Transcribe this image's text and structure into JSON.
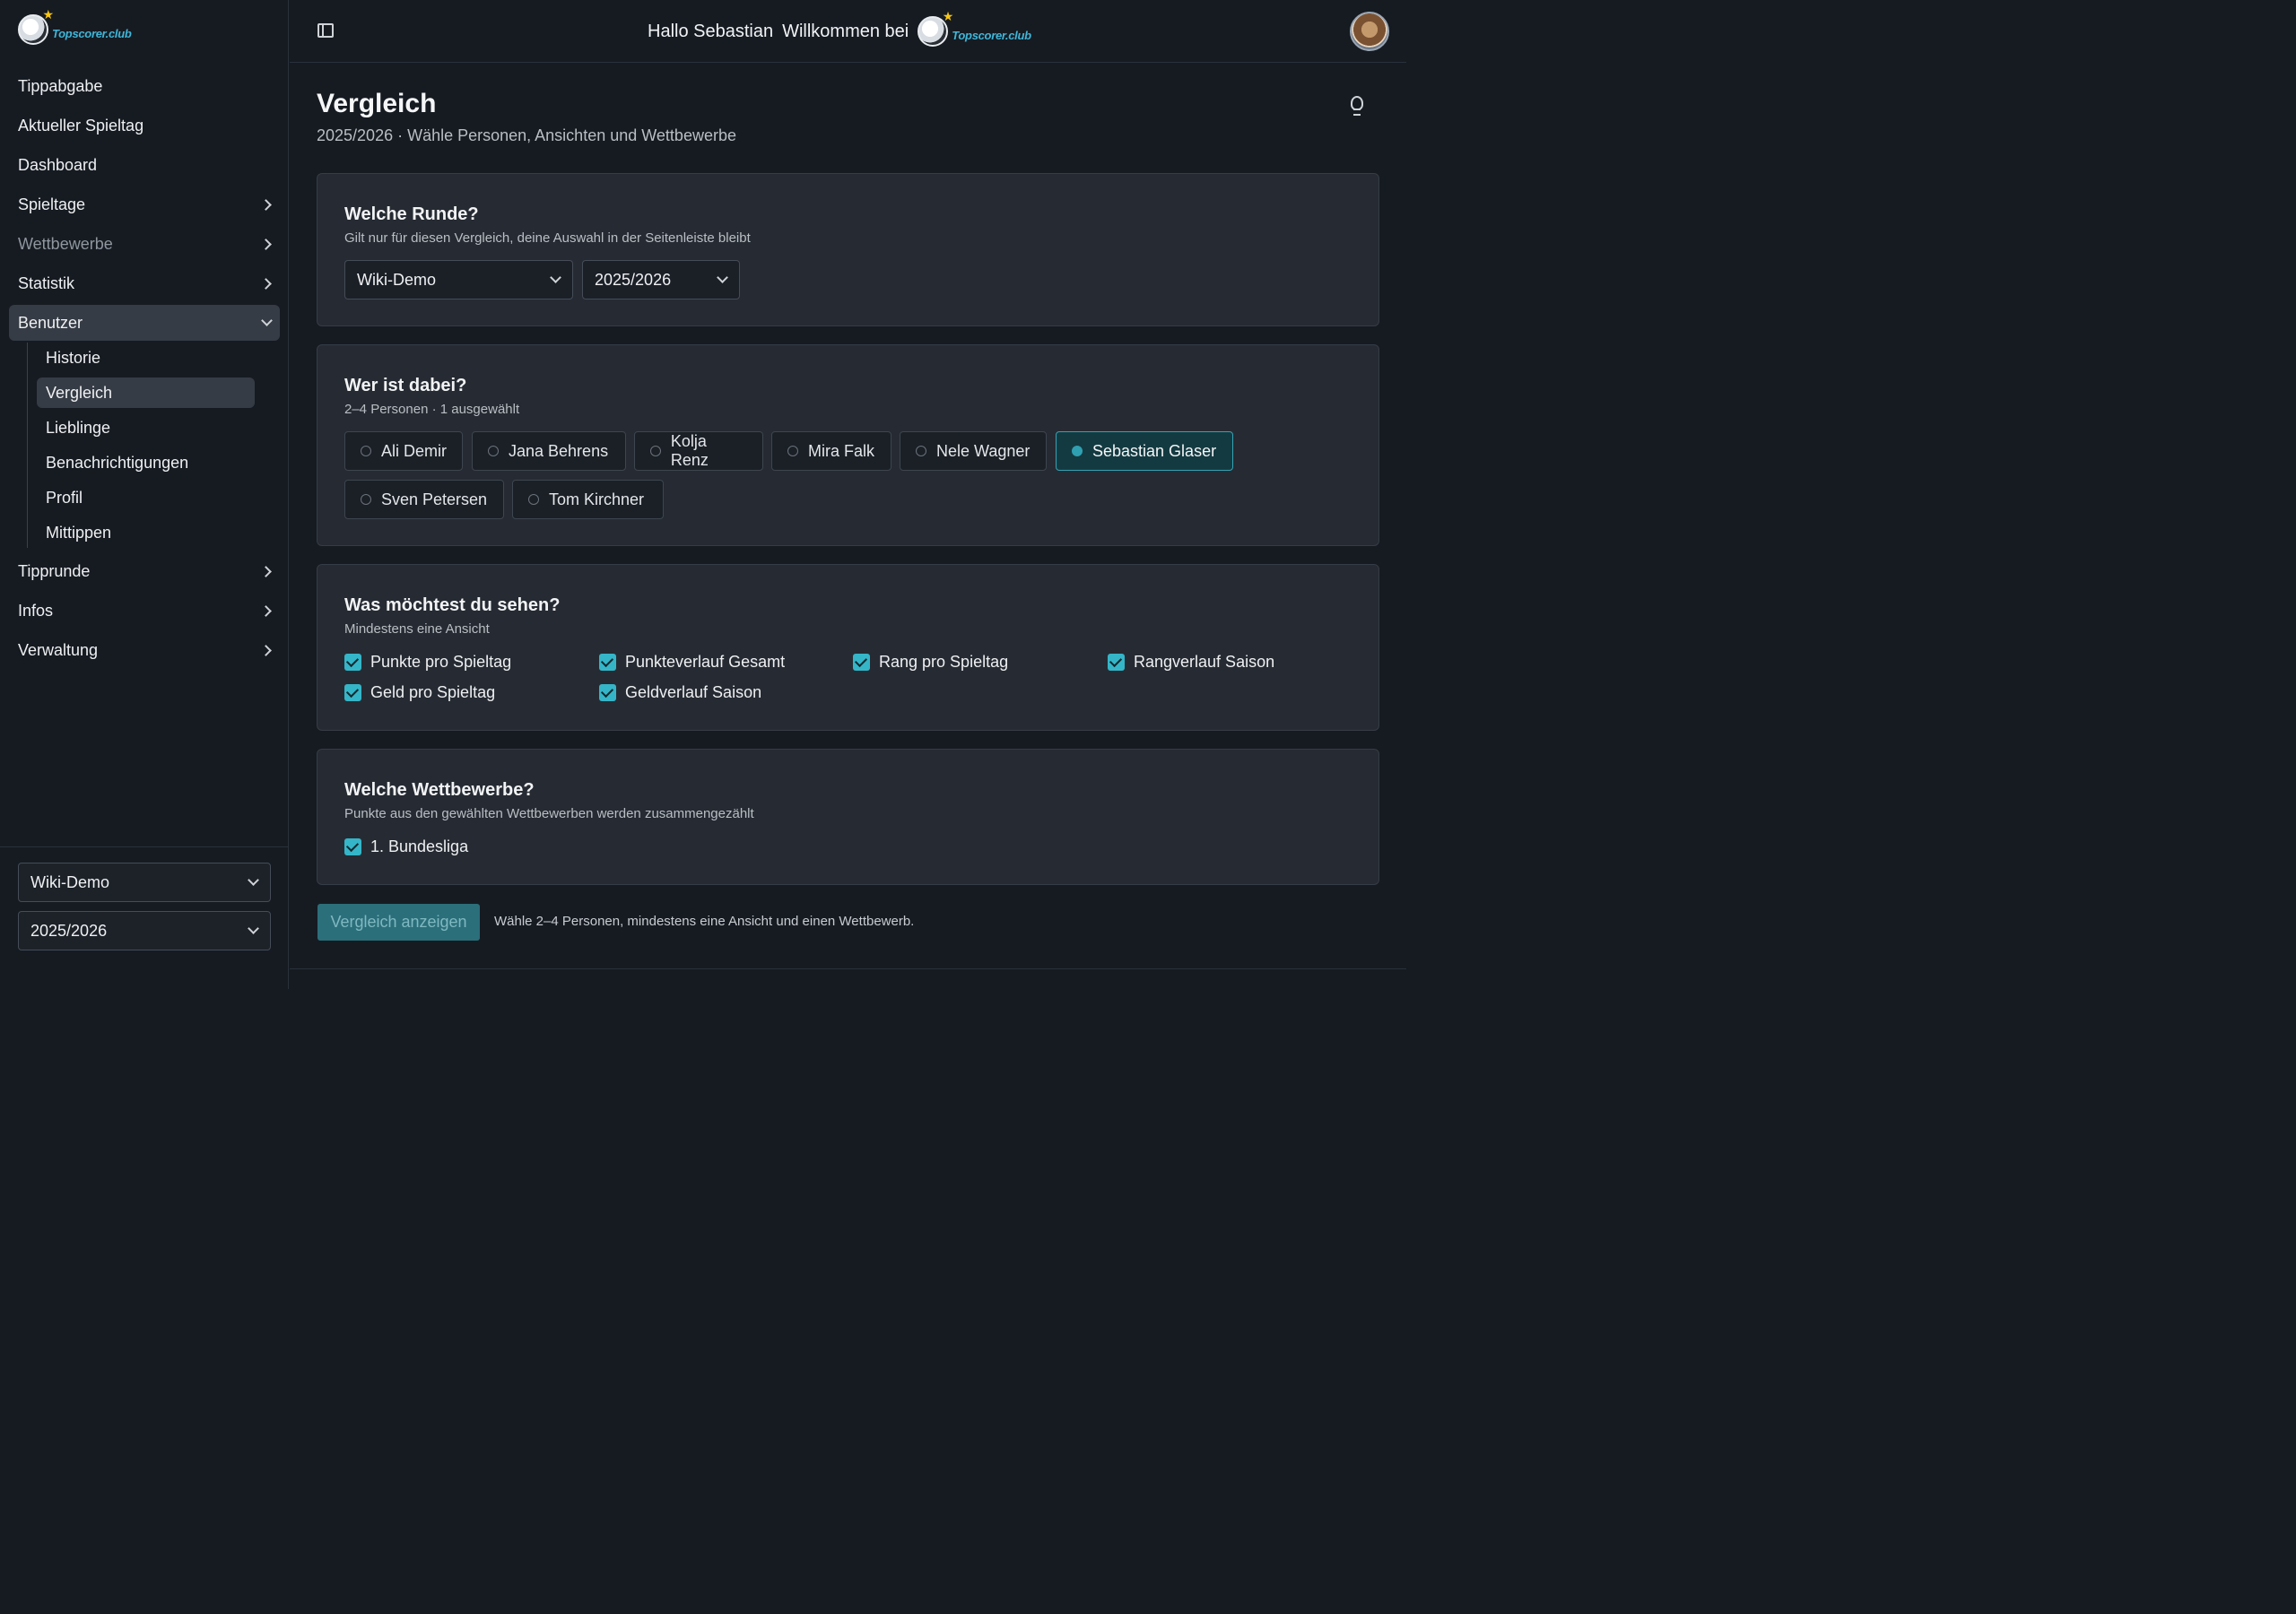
{
  "brand": {
    "logo_text": "Topscorer.club",
    "accent": "#35b5c8"
  },
  "header": {
    "greeting_hello": "Hallo Sebastian",
    "greeting_welcome": "Willkommen bei",
    "logo_text": "Topscorer.club"
  },
  "sidebar": {
    "items": [
      {
        "label": "Tippabgabe"
      },
      {
        "label": "Aktueller Spieltag"
      },
      {
        "label": "Dashboard"
      },
      {
        "label": "Spieltage"
      },
      {
        "label": "Wettbewerbe"
      },
      {
        "label": "Statistik"
      },
      {
        "label": "Benutzer"
      },
      {
        "label": "Tipprunde"
      },
      {
        "label": "Infos"
      },
      {
        "label": "Verwaltung"
      }
    ],
    "benutzer_sub": [
      {
        "label": "Historie"
      },
      {
        "label": "Vergleich"
      },
      {
        "label": "Lieblinge"
      },
      {
        "label": "Benachrichtigungen"
      },
      {
        "label": "Profil"
      },
      {
        "label": "Mittippen"
      }
    ],
    "round_select": "Wiki-Demo",
    "season_select": "2025/2026"
  },
  "page": {
    "title": "Vergleich",
    "subtitle": "2025/2026 · Wähle Personen, Ansichten und Wettbewerbe"
  },
  "round_card": {
    "title": "Welche Runde?",
    "desc": "Gilt nur für diesen Vergleich, deine Auswahl in der Seitenleiste bleibt",
    "round_value": "Wiki-Demo",
    "season_value": "2025/2026"
  },
  "people_card": {
    "title": "Wer ist dabei?",
    "desc": "2–4 Personen · 1 ausgewählt",
    "people": [
      {
        "name": "Ali Demir",
        "selected": false
      },
      {
        "name": "Jana Behrens",
        "selected": false
      },
      {
        "name": "Kolja Renz",
        "selected": false
      },
      {
        "name": "Mira Falk",
        "selected": false
      },
      {
        "name": "Nele Wagner",
        "selected": false
      },
      {
        "name": "Sebastian Glaser",
        "selected": true
      },
      {
        "name": "Sven Petersen",
        "selected": false
      },
      {
        "name": "Tom Kirchner",
        "selected": false
      }
    ]
  },
  "views_card": {
    "title": "Was möchtest du sehen?",
    "desc": "Mindestens eine Ansicht",
    "options": [
      {
        "label": "Punkte pro Spieltag",
        "checked": true
      },
      {
        "label": "Punkteverlauf Gesamt",
        "checked": true
      },
      {
        "label": "Rang pro Spieltag",
        "checked": true
      },
      {
        "label": "Rangverlauf Saison",
        "checked": true
      },
      {
        "label": "Geld pro Spieltag",
        "checked": true
      },
      {
        "label": "Geldverlauf Saison",
        "checked": true
      }
    ]
  },
  "comps_card": {
    "title": "Welche Wettbewerbe?",
    "desc": "Punkte aus den gewählten Wettbewerben werden zusammengezählt",
    "options": [
      {
        "label": "1. Bundesliga",
        "checked": true
      }
    ]
  },
  "actions": {
    "submit_label": "Vergleich anzeigen",
    "hint": "Wähle 2–4 Personen, mindestens eine Ansicht und einen Wettbewerb."
  }
}
